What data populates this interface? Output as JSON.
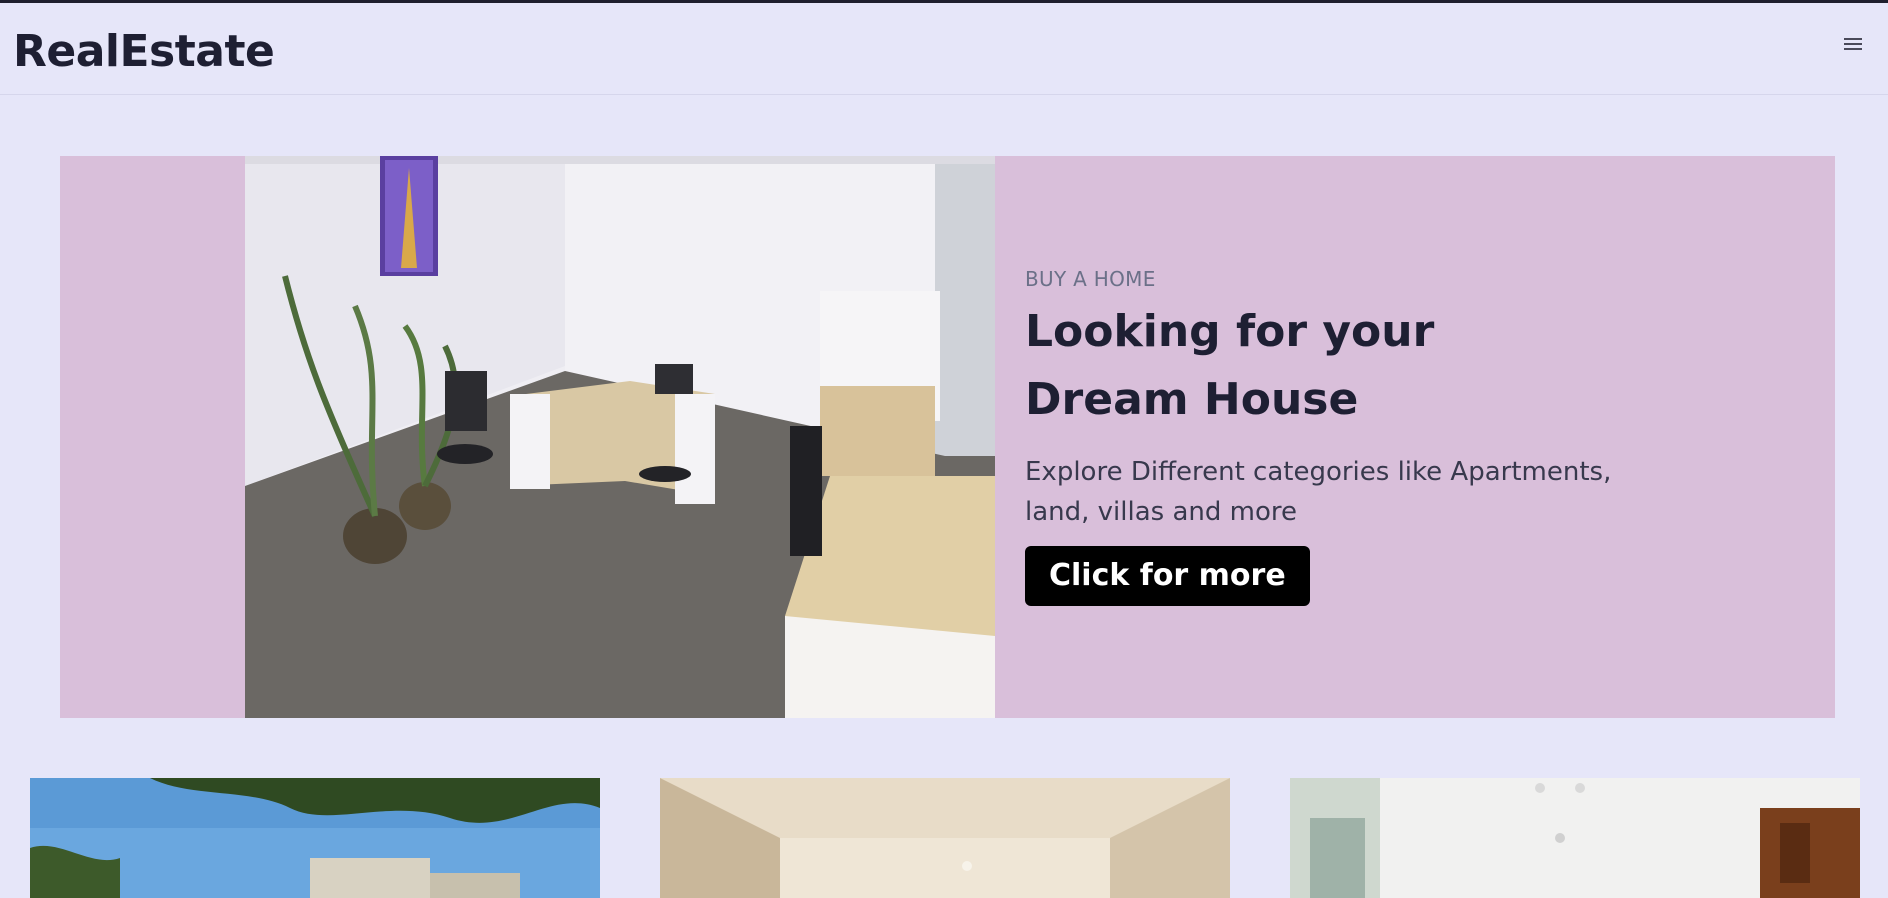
{
  "header": {
    "brand": "RealEstate",
    "menu_icon": "hamburger-menu-icon"
  },
  "hero": {
    "eyebrow": "BUY A HOME",
    "headline": "Looking for your Dream House",
    "description": "Explore Different categories like Apartments, land, villas and more",
    "cta_label": "Click for more",
    "background_color": "#d9bfda"
  },
  "listings": [
    {
      "image": "building-exterior-photo"
    },
    {
      "image": "empty-room-photo"
    },
    {
      "image": "apartment-interior-photo"
    }
  ]
}
